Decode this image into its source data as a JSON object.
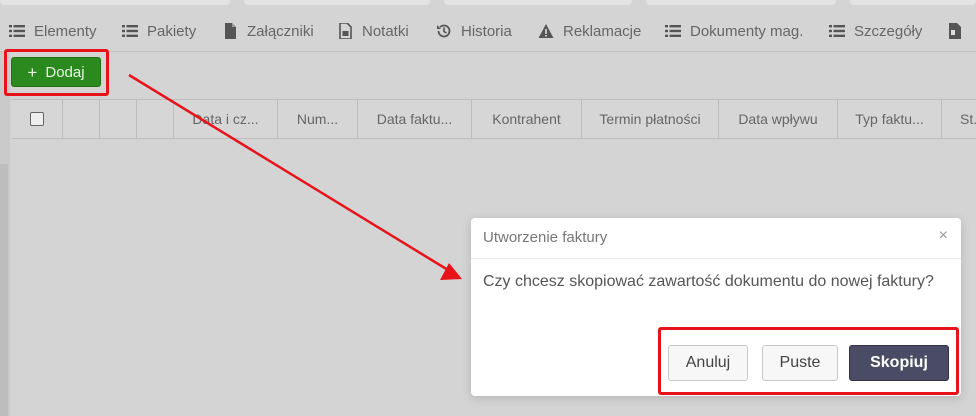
{
  "tabs": [
    {
      "label": "Elementy",
      "icon": "list-icon"
    },
    {
      "label": "Pakiety",
      "icon": "list-icon"
    },
    {
      "label": "Załączniki",
      "icon": "file-icon"
    },
    {
      "label": "Notatki",
      "icon": "note-icon"
    },
    {
      "label": "Historia",
      "icon": "history-icon"
    },
    {
      "label": "Reklamacje",
      "icon": "warning-icon"
    },
    {
      "label": "Dokumenty mag.",
      "icon": "list-icon"
    },
    {
      "label": "Szczegóły",
      "icon": "list-icon"
    }
  ],
  "toolbar": {
    "add_label": "Dodaj",
    "add_icon": "plus-icon"
  },
  "table": {
    "columns": [
      "Data i cz...",
      "Num...",
      "Data faktu...",
      "Kontrahent",
      "Termin płatności",
      "Data wpływu",
      "Typ faktu...",
      "St..."
    ]
  },
  "dialog": {
    "title": "Utworzenie faktury",
    "close_glyph": "×",
    "message": "Czy chcesz skopiować zawartość dokumentu do nowej faktury?",
    "cancel_label": "Anuluj",
    "empty_label": "Puste",
    "copy_label": "Skopiuj"
  },
  "colors": {
    "add_button": "#2b8a1e",
    "primary_button": "#4a4c66",
    "highlight": "#e8131a"
  }
}
